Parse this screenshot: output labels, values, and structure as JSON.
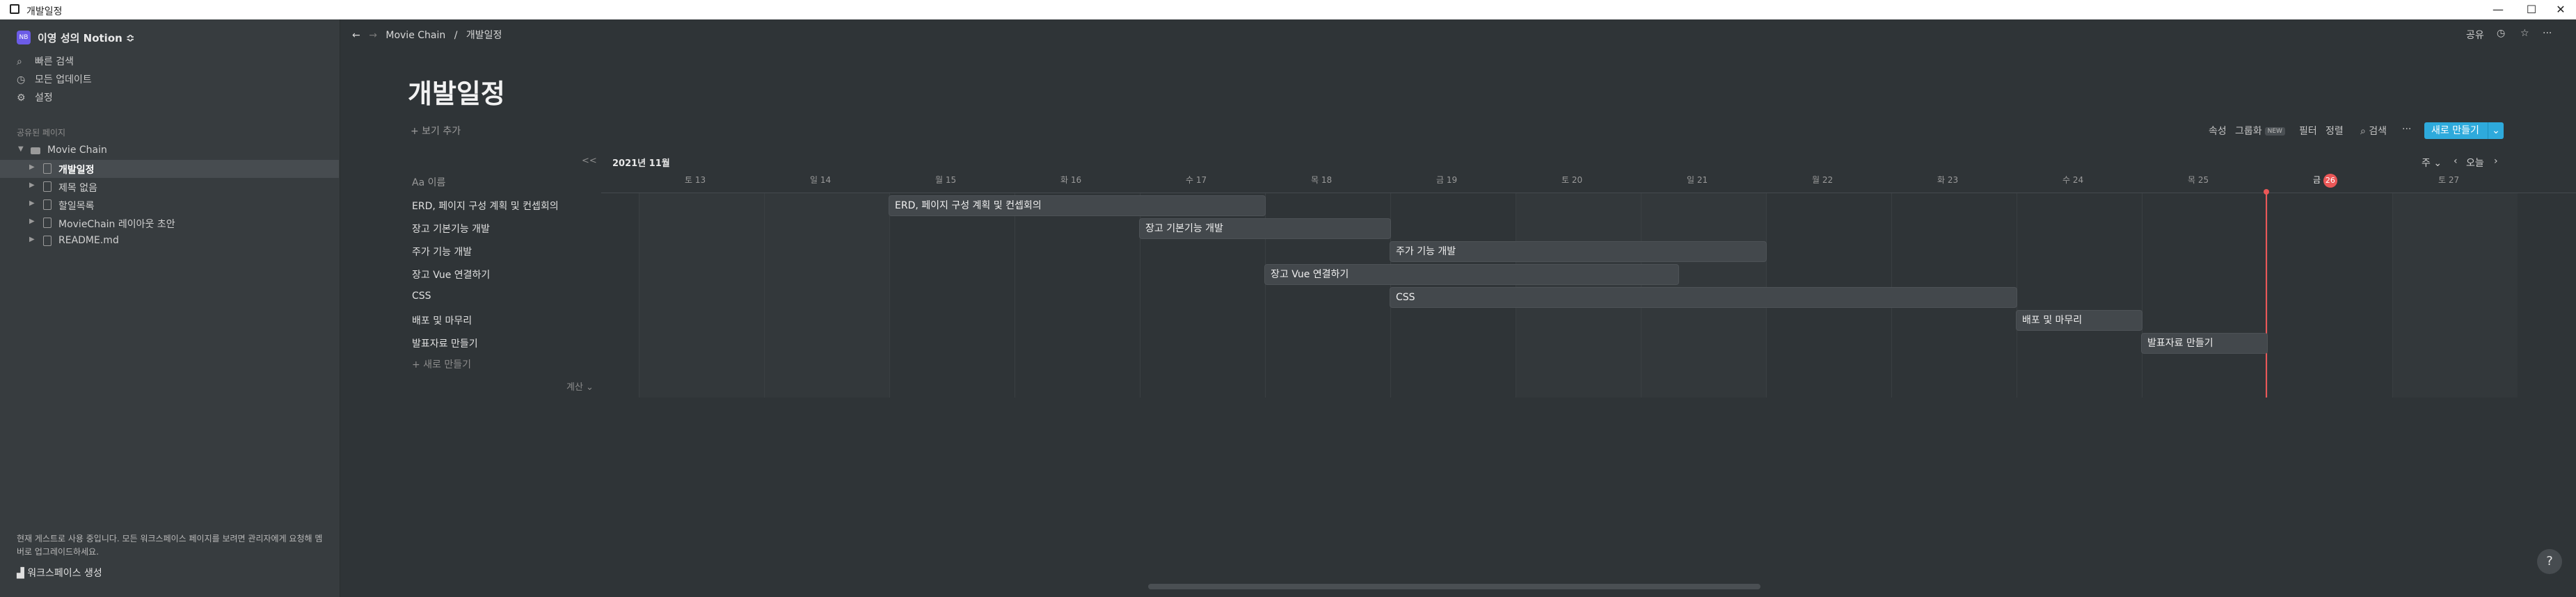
{
  "window": {
    "title": "개발일정",
    "minimize": "—",
    "maximize": "☐",
    "close": "✕"
  },
  "sidebar": {
    "workspace_avatar": "NB",
    "workspace_name": "이영 성의 Notion ≎",
    "links": [
      {
        "icon": "search-icon",
        "glyph": "⌕",
        "label": "빠른 검색"
      },
      {
        "icon": "clock-icon",
        "glyph": "◷",
        "label": "모든 업데이트"
      },
      {
        "icon": "gear-icon",
        "glyph": "⚙",
        "label": "설정"
      }
    ],
    "section_label": "공유된 페이지",
    "tree": [
      {
        "label": "Movie Chain",
        "level": 0
      },
      {
        "label": "개발일정",
        "level": 1,
        "active": true
      },
      {
        "label": "제목 없음",
        "level": 1
      },
      {
        "label": "할일목록",
        "level": 1
      },
      {
        "label": "MovieChain 레이아웃 초안",
        "level": 1
      },
      {
        "label": "README.md",
        "level": 1
      }
    ],
    "bottom_text": "현재 게스트로 사용 중입니다. 모든 워크스페이스 페이지를 보려면 관리자에게 요청해 멤버로 업그레이드하세요.",
    "create_workspace": "워크스페이스 생성"
  },
  "topbar": {
    "breadcrumb": [
      "Movie Chain",
      "/",
      "개발일정"
    ],
    "share": "공유"
  },
  "page": {
    "title": "개발일정",
    "add_view": "+ 보기 추가"
  },
  "dbbar": {
    "properties": "속성",
    "group": "그룹화",
    "new_badge": "NEW",
    "filter": "필터",
    "sort": "정렬",
    "search": "⌕ 검색",
    "more": "···",
    "new_button": "새로 만들기",
    "new_caret": "⌄"
  },
  "timeline": {
    "collapse": "<<",
    "month": "2021년 11월",
    "scale": "주 ⌄",
    "prev": "‹",
    "today": "오늘",
    "next": "›",
    "name_header": "Aa 이름",
    "new_row": "+ 새로 만들기",
    "count": "계산 ⌄",
    "days": [
      {
        "label": "토 13",
        "weekend": true
      },
      {
        "label": "일 14",
        "weekend": true
      },
      {
        "label": "월 15"
      },
      {
        "label": "화 16"
      },
      {
        "label": "수 17"
      },
      {
        "label": "목 18"
      },
      {
        "label": "금 19"
      },
      {
        "label": "토 20",
        "weekend": true
      },
      {
        "label": "일 21",
        "weekend": true
      },
      {
        "label": "월 22"
      },
      {
        "label": "화 23"
      },
      {
        "label": "수 24"
      },
      {
        "label": "목 25"
      },
      {
        "label": "금",
        "today_num": "26",
        "today": true
      },
      {
        "label": "토 27",
        "weekend": true
      }
    ],
    "tasks": [
      {
        "name": "ERD, 페이지 구성 계획 및 컨셉회의",
        "start": 2,
        "end": 5
      },
      {
        "name": "장고 기본기능 개발",
        "start": 4,
        "end": 6
      },
      {
        "name": "주가 기능 개발",
        "start": 6,
        "end": 9
      },
      {
        "name": "장고 Vue 연결하기",
        "start": 5,
        "end": 8.3
      },
      {
        "name": "CSS",
        "start": 6,
        "end": 11
      },
      {
        "name": "배포 및 마무리",
        "start": 11,
        "end": 12
      },
      {
        "name": "발표자료 만들기",
        "start": 12,
        "end": 13
      }
    ],
    "today_index": 13
  },
  "help": "?",
  "colors": {
    "accent": "#2eaadc",
    "today": "#eb5757",
    "bg": "#2f3437",
    "sidebar": "#373c3f"
  }
}
